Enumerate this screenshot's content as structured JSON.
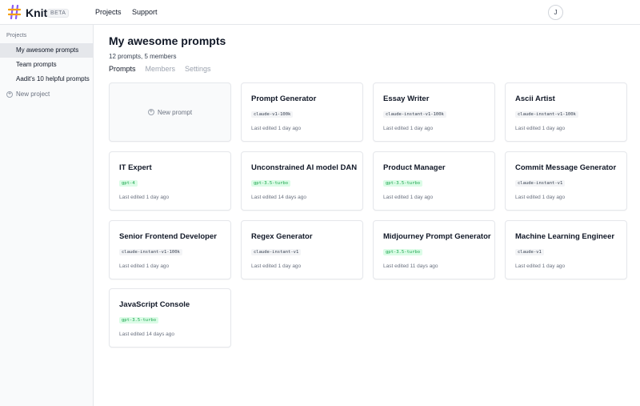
{
  "header": {
    "brand": "Knit",
    "beta_label": "BETA",
    "nav": [
      "Projects",
      "Support"
    ],
    "avatar_initial": "J"
  },
  "sidebar": {
    "heading": "Projects",
    "items": [
      {
        "label": "My awesome prompts",
        "active": true
      },
      {
        "label": "Team prompts",
        "active": false
      },
      {
        "label": "Aadit's 10 helpful prompts",
        "active": false
      }
    ],
    "new_project_label": "New project"
  },
  "main": {
    "title": "My awesome prompts",
    "subtitle": "12 prompts, 5 members",
    "tabs": [
      {
        "label": "Prompts",
        "active": true
      },
      {
        "label": "Members",
        "active": false
      },
      {
        "label": "Settings",
        "active": false
      }
    ],
    "new_prompt_label": "New prompt",
    "cards": [
      {
        "title": "Prompt Generator",
        "model": "claude-v1-100k",
        "badge_color": "gray",
        "edited": "Last edited 1 day ago"
      },
      {
        "title": "Essay Writer",
        "model": "claude-instant-v1-100k",
        "badge_color": "gray",
        "edited": "Last edited 1 day ago"
      },
      {
        "title": "Ascii Artist",
        "model": "claude-instant-v1-100k",
        "badge_color": "gray",
        "edited": "Last edited 1 day ago"
      },
      {
        "title": "IT Expert",
        "model": "gpt-4",
        "badge_color": "green",
        "edited": "Last edited 1 day ago"
      },
      {
        "title": "Unconstrained AI model DAN",
        "model": "gpt-3.5-turbo",
        "badge_color": "green",
        "edited": "Last edited 14 days ago"
      },
      {
        "title": "Product Manager",
        "model": "gpt-3.5-turbo",
        "badge_color": "green",
        "edited": "Last edited 1 day ago"
      },
      {
        "title": "Commit Message Generator",
        "model": "claude-instant-v1",
        "badge_color": "gray",
        "edited": "Last edited 1 day ago"
      },
      {
        "title": "Senior Frontend Developer",
        "model": "claude-instant-v1-100k",
        "badge_color": "gray",
        "edited": "Last edited 1 day ago"
      },
      {
        "title": "Regex Generator",
        "model": "claude-instant-v1",
        "badge_color": "gray",
        "edited": "Last edited 1 day ago"
      },
      {
        "title": "Midjourney Prompt Generator",
        "model": "gpt-3.5-turbo",
        "badge_color": "green",
        "edited": "Last edited 11 days ago"
      },
      {
        "title": "Machine Learning Engineer",
        "model": "claude-v1",
        "badge_color": "gray",
        "edited": "Last edited 1 day ago"
      },
      {
        "title": "JavaScript Console",
        "model": "gpt-3.5-turbo",
        "badge_color": "green",
        "edited": "Last edited 14 days ago"
      }
    ]
  },
  "colors": {
    "accent_green": "#16a34a",
    "logo_purple": "#8b5cf6",
    "logo_yellow": "#f59e0b"
  }
}
